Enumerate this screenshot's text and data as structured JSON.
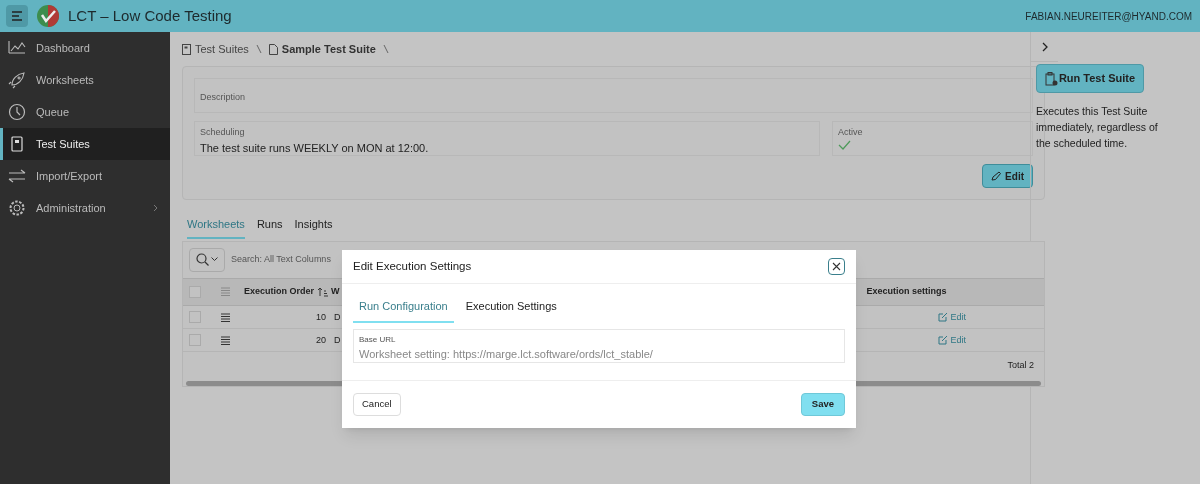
{
  "header": {
    "title": "LCT – Low Code Testing",
    "user": "FABIAN.NEUREITER@HYAND.COM"
  },
  "sidebar": {
    "items": [
      {
        "label": "Dashboard",
        "selected": false,
        "has_submenu": false
      },
      {
        "label": "Worksheets",
        "selected": false,
        "has_submenu": false
      },
      {
        "label": "Queue",
        "selected": false,
        "has_submenu": false
      },
      {
        "label": "Test Suites",
        "selected": true,
        "has_submenu": false
      },
      {
        "label": "Import/Export",
        "selected": false,
        "has_submenu": false
      },
      {
        "label": "Administration",
        "selected": false,
        "has_submenu": true
      }
    ]
  },
  "breadcrumb": [
    {
      "label": "Test Suites",
      "current": false
    },
    {
      "label": "Sample Test Suite",
      "current": true
    }
  ],
  "details": {
    "description": {
      "label": "Description"
    },
    "scheduling": {
      "label": "Scheduling",
      "value": "The test suite runs WEEKLY on MON at 12:00."
    },
    "active": {
      "label": "Active",
      "checked": true
    },
    "edit_button": "Edit"
  },
  "side_panel": {
    "button": "Run Test Suite",
    "text": "Executes this Test Suite immediately, regardless of the scheduled time."
  },
  "tabs": [
    {
      "label": "Worksheets",
      "selected": true
    },
    {
      "label": "Runs",
      "selected": false
    },
    {
      "label": "Insights",
      "selected": false
    }
  ],
  "table": {
    "search_placeholder": "Search: All Text Columns",
    "select_all_checked": false,
    "columns": [
      "Execution Order",
      "W",
      "Execution settings"
    ],
    "rows": [
      {
        "checked": false,
        "order": "10",
        "column_2": "D",
        "action": "Edit"
      },
      {
        "checked": false,
        "order": "20",
        "column_2": "D",
        "action": "Edit"
      }
    ],
    "total": "Total 2"
  },
  "dialog": {
    "title": "Edit Execution Settings",
    "tabs": [
      {
        "label": "Run Configuration",
        "selected": true
      },
      {
        "label": "Execution Settings",
        "selected": false
      }
    ],
    "field": {
      "label": "Base URL",
      "placeholder": "Worksheet setting: https://marge.lct.software/ords/lct_stable/"
    },
    "buttons": {
      "cancel": "Cancel",
      "save": "Save"
    }
  }
}
